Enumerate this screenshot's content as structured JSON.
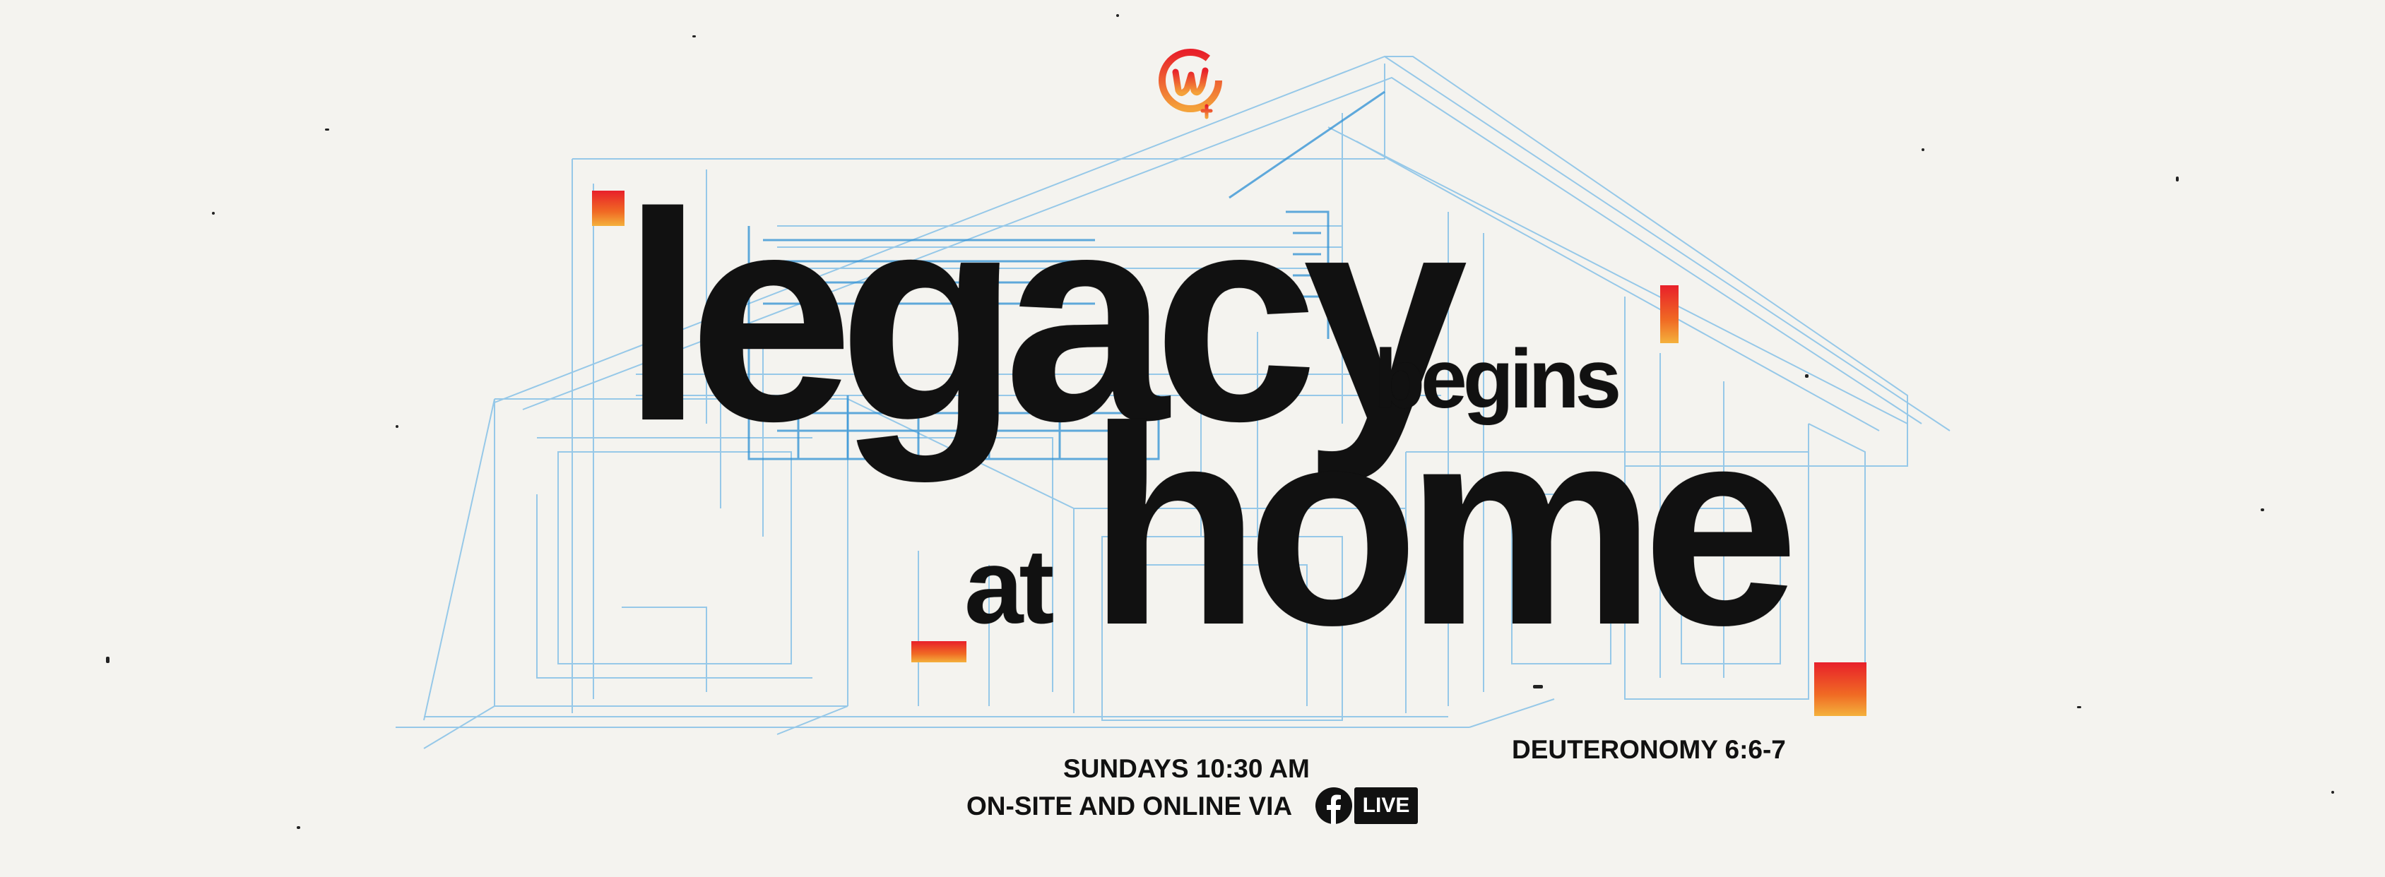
{
  "title": {
    "word1": "legacy",
    "word2": "begins",
    "word3": "at",
    "word4": "home"
  },
  "schedule": "SUNDAYS 10:30 AM",
  "online": "ON-SITE AND ONLINE VIA",
  "live_badge": "LIVE",
  "scripture": "DEUTERONOMY 6:6-7",
  "icons": {
    "logo": "church-logo-icon",
    "facebook": "facebook-icon"
  },
  "colors": {
    "accent_red": "#e8202a",
    "accent_orange": "#f06a24",
    "accent_yellow": "#f4b13c",
    "blueprint_blue": "#5aa9dd",
    "text": "#111111",
    "background": "#f4f3ef"
  }
}
